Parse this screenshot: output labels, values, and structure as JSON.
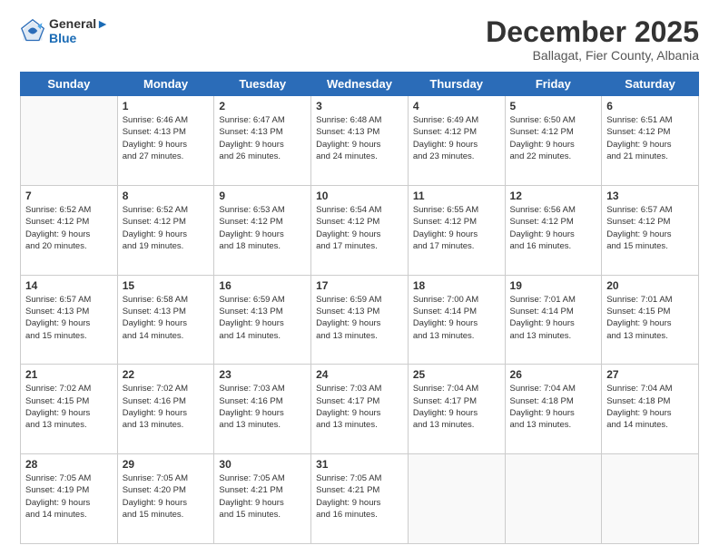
{
  "header": {
    "logo_line1": "General",
    "logo_line2": "Blue",
    "month": "December 2025",
    "location": "Ballagat, Fier County, Albania"
  },
  "weekdays": [
    "Sunday",
    "Monday",
    "Tuesday",
    "Wednesday",
    "Thursday",
    "Friday",
    "Saturday"
  ],
  "weeks": [
    [
      {
        "day": "",
        "info": ""
      },
      {
        "day": "1",
        "info": "Sunrise: 6:46 AM\nSunset: 4:13 PM\nDaylight: 9 hours\nand 27 minutes."
      },
      {
        "day": "2",
        "info": "Sunrise: 6:47 AM\nSunset: 4:13 PM\nDaylight: 9 hours\nand 26 minutes."
      },
      {
        "day": "3",
        "info": "Sunrise: 6:48 AM\nSunset: 4:13 PM\nDaylight: 9 hours\nand 24 minutes."
      },
      {
        "day": "4",
        "info": "Sunrise: 6:49 AM\nSunset: 4:12 PM\nDaylight: 9 hours\nand 23 minutes."
      },
      {
        "day": "5",
        "info": "Sunrise: 6:50 AM\nSunset: 4:12 PM\nDaylight: 9 hours\nand 22 minutes."
      },
      {
        "day": "6",
        "info": "Sunrise: 6:51 AM\nSunset: 4:12 PM\nDaylight: 9 hours\nand 21 minutes."
      }
    ],
    [
      {
        "day": "7",
        "info": "Sunrise: 6:52 AM\nSunset: 4:12 PM\nDaylight: 9 hours\nand 20 minutes."
      },
      {
        "day": "8",
        "info": "Sunrise: 6:52 AM\nSunset: 4:12 PM\nDaylight: 9 hours\nand 19 minutes."
      },
      {
        "day": "9",
        "info": "Sunrise: 6:53 AM\nSunset: 4:12 PM\nDaylight: 9 hours\nand 18 minutes."
      },
      {
        "day": "10",
        "info": "Sunrise: 6:54 AM\nSunset: 4:12 PM\nDaylight: 9 hours\nand 17 minutes."
      },
      {
        "day": "11",
        "info": "Sunrise: 6:55 AM\nSunset: 4:12 PM\nDaylight: 9 hours\nand 17 minutes."
      },
      {
        "day": "12",
        "info": "Sunrise: 6:56 AM\nSunset: 4:12 PM\nDaylight: 9 hours\nand 16 minutes."
      },
      {
        "day": "13",
        "info": "Sunrise: 6:57 AM\nSunset: 4:12 PM\nDaylight: 9 hours\nand 15 minutes."
      }
    ],
    [
      {
        "day": "14",
        "info": "Sunrise: 6:57 AM\nSunset: 4:13 PM\nDaylight: 9 hours\nand 15 minutes."
      },
      {
        "day": "15",
        "info": "Sunrise: 6:58 AM\nSunset: 4:13 PM\nDaylight: 9 hours\nand 14 minutes."
      },
      {
        "day": "16",
        "info": "Sunrise: 6:59 AM\nSunset: 4:13 PM\nDaylight: 9 hours\nand 14 minutes."
      },
      {
        "day": "17",
        "info": "Sunrise: 6:59 AM\nSunset: 4:13 PM\nDaylight: 9 hours\nand 13 minutes."
      },
      {
        "day": "18",
        "info": "Sunrise: 7:00 AM\nSunset: 4:14 PM\nDaylight: 9 hours\nand 13 minutes."
      },
      {
        "day": "19",
        "info": "Sunrise: 7:01 AM\nSunset: 4:14 PM\nDaylight: 9 hours\nand 13 minutes."
      },
      {
        "day": "20",
        "info": "Sunrise: 7:01 AM\nSunset: 4:15 PM\nDaylight: 9 hours\nand 13 minutes."
      }
    ],
    [
      {
        "day": "21",
        "info": "Sunrise: 7:02 AM\nSunset: 4:15 PM\nDaylight: 9 hours\nand 13 minutes."
      },
      {
        "day": "22",
        "info": "Sunrise: 7:02 AM\nSunset: 4:16 PM\nDaylight: 9 hours\nand 13 minutes."
      },
      {
        "day": "23",
        "info": "Sunrise: 7:03 AM\nSunset: 4:16 PM\nDaylight: 9 hours\nand 13 minutes."
      },
      {
        "day": "24",
        "info": "Sunrise: 7:03 AM\nSunset: 4:17 PM\nDaylight: 9 hours\nand 13 minutes."
      },
      {
        "day": "25",
        "info": "Sunrise: 7:04 AM\nSunset: 4:17 PM\nDaylight: 9 hours\nand 13 minutes."
      },
      {
        "day": "26",
        "info": "Sunrise: 7:04 AM\nSunset: 4:18 PM\nDaylight: 9 hours\nand 13 minutes."
      },
      {
        "day": "27",
        "info": "Sunrise: 7:04 AM\nSunset: 4:18 PM\nDaylight: 9 hours\nand 14 minutes."
      }
    ],
    [
      {
        "day": "28",
        "info": "Sunrise: 7:05 AM\nSunset: 4:19 PM\nDaylight: 9 hours\nand 14 minutes."
      },
      {
        "day": "29",
        "info": "Sunrise: 7:05 AM\nSunset: 4:20 PM\nDaylight: 9 hours\nand 15 minutes."
      },
      {
        "day": "30",
        "info": "Sunrise: 7:05 AM\nSunset: 4:21 PM\nDaylight: 9 hours\nand 15 minutes."
      },
      {
        "day": "31",
        "info": "Sunrise: 7:05 AM\nSunset: 4:21 PM\nDaylight: 9 hours\nand 16 minutes."
      },
      {
        "day": "",
        "info": ""
      },
      {
        "day": "",
        "info": ""
      },
      {
        "day": "",
        "info": ""
      }
    ]
  ]
}
